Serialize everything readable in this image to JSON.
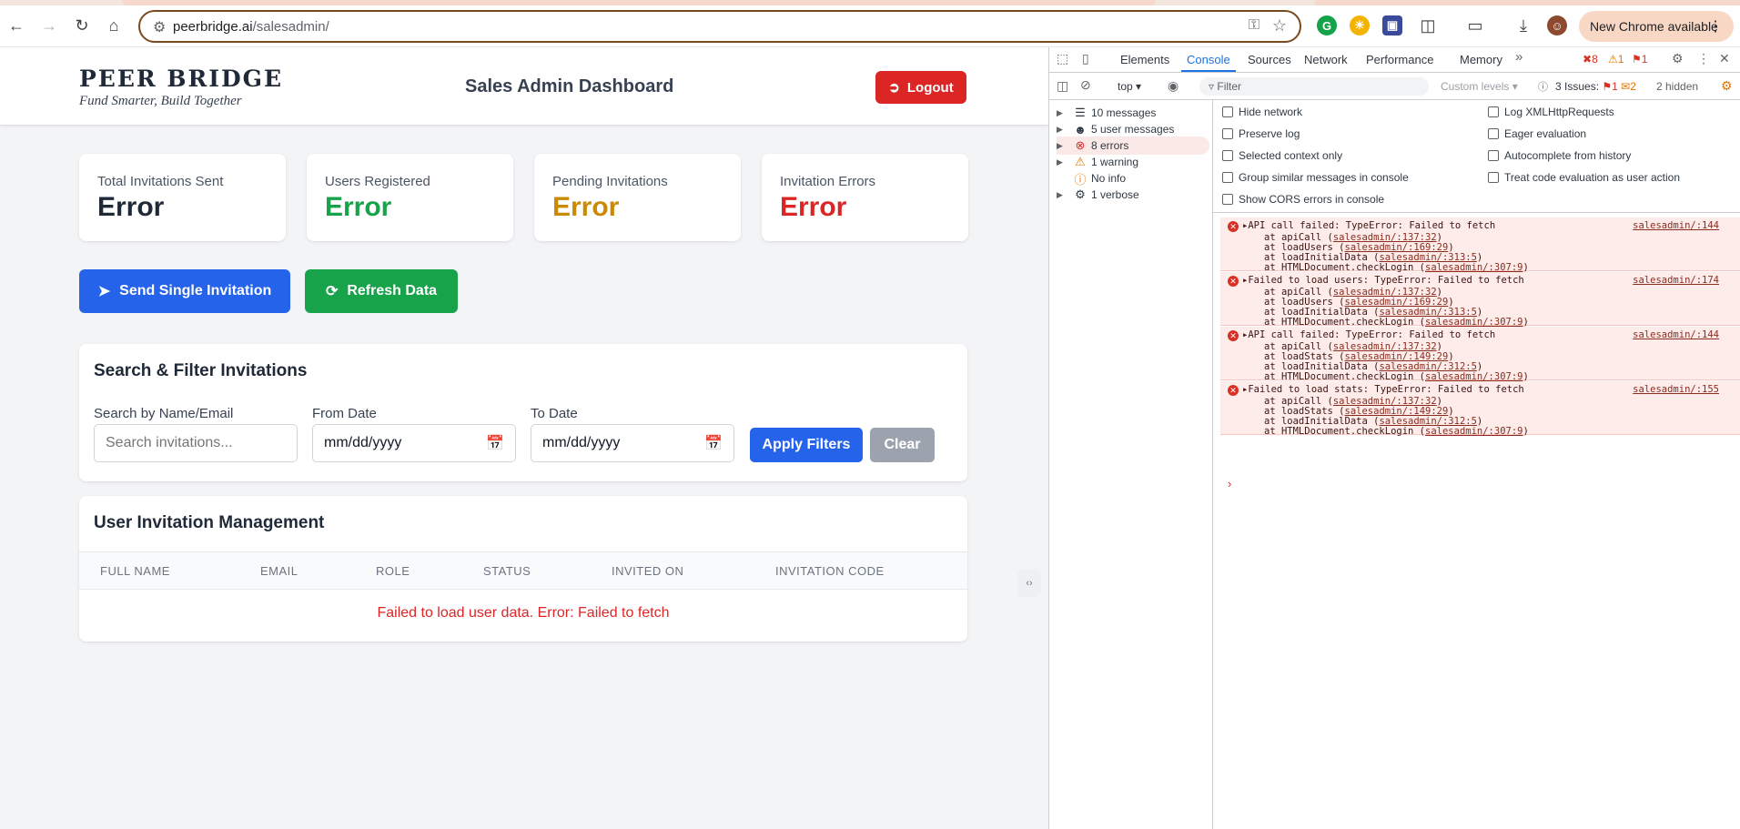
{
  "browser": {
    "url_host": "peerbridge.ai",
    "url_path": "/salesadmin/",
    "new_chrome_label": "New Chrome available"
  },
  "header": {
    "brand_name": "PEER BRIDGE",
    "brand_tagline": "Fund Smarter, Build Together",
    "title": "Sales Admin Dashboard",
    "logout_label": "Logout"
  },
  "stats": [
    {
      "label": "Total Invitations Sent",
      "value": "Error",
      "color": "#1f2937"
    },
    {
      "label": "Users Registered",
      "value": "Error",
      "color": "#16a34a"
    },
    {
      "label": "Pending Invitations",
      "value": "Error",
      "color": "#ca8a04"
    },
    {
      "label": "Invitation Errors",
      "value": "Error",
      "color": "#dc2626"
    }
  ],
  "actions": {
    "send_label": "Send Single Invitation",
    "refresh_label": "Refresh Data"
  },
  "filters": {
    "title": "Search & Filter Invitations",
    "search_label": "Search by Name/Email",
    "search_placeholder": "Search invitations...",
    "from_label": "From Date",
    "from_value": "mm/dd/yyyy",
    "to_label": "To Date",
    "to_value": "mm/dd/yyyy",
    "apply_label": "Apply Filters",
    "clear_label": "Clear"
  },
  "table": {
    "title": "User Invitation Management",
    "columns": [
      "FULL NAME",
      "EMAIL",
      "ROLE",
      "STATUS",
      "INVITED ON",
      "INVITATION CODE"
    ],
    "message": "Failed to load user data. Error: Failed to fetch"
  },
  "devtools": {
    "tabs": [
      "Elements",
      "Console",
      "Sources",
      "Network",
      "Performance",
      "Memory"
    ],
    "error_count": "8",
    "warning_count": "1",
    "issue_count": "1",
    "context": "top",
    "filter_placeholder": "Filter",
    "levels": "Custom levels",
    "issues_label": "3 Issues:",
    "issues_err": "1",
    "issues_info": "2",
    "hidden_label": "2 hidden",
    "sidebar": [
      {
        "label": "10 messages",
        "icon": "list-icon"
      },
      {
        "label": "5 user messages",
        "icon": "user-icon"
      },
      {
        "label": "8 errors",
        "icon": "error-icon"
      },
      {
        "label": "1 warning",
        "icon": "warning-icon"
      },
      {
        "label": "No info",
        "icon": "info-icon"
      },
      {
        "label": "1 verbose",
        "icon": "bug-icon"
      }
    ],
    "options_left": [
      "Hide network",
      "Preserve log",
      "Selected context only",
      "Group similar messages in console",
      "Show CORS errors in console"
    ],
    "options_right": [
      "Log XMLHttpRequests",
      "Eager evaluation",
      "Autocomplete from history",
      "Treat code evaluation as user action"
    ],
    "errors": [
      {
        "message": "API call failed: TypeError: Failed to fetch",
        "source": "salesadmin/:144",
        "stack": [
          [
            "at apiCall (",
            "salesadmin/:137:32",
            ")"
          ],
          [
            "at loadUsers (",
            "salesadmin/:169:29",
            ")"
          ],
          [
            "at loadInitialData (",
            "salesadmin/:313:5",
            ")"
          ],
          [
            "at HTMLDocument.checkLogin (",
            "salesadmin/:307:9",
            ")"
          ]
        ]
      },
      {
        "message": "Failed to load users: TypeError: Failed to fetch",
        "source": "salesadmin/:174",
        "stack": [
          [
            "at apiCall (",
            "salesadmin/:137:32",
            ")"
          ],
          [
            "at loadUsers (",
            "salesadmin/:169:29",
            ")"
          ],
          [
            "at loadInitialData (",
            "salesadmin/:313:5",
            ")"
          ],
          [
            "at HTMLDocument.checkLogin (",
            "salesadmin/:307:9",
            ")"
          ]
        ]
      },
      {
        "message": "API call failed: TypeError: Failed to fetch",
        "source": "salesadmin/:144",
        "stack": [
          [
            "at apiCall (",
            "salesadmin/:137:32",
            ")"
          ],
          [
            "at loadStats (",
            "salesadmin/:149:29",
            ")"
          ],
          [
            "at loadInitialData (",
            "salesadmin/:312:5",
            ")"
          ],
          [
            "at HTMLDocument.checkLogin (",
            "salesadmin/:307:9",
            ")"
          ]
        ]
      },
      {
        "message": "Failed to load stats: TypeError: Failed to fetch",
        "source": "salesadmin/:155",
        "stack": [
          [
            "at apiCall (",
            "salesadmin/:137:32",
            ")"
          ],
          [
            "at loadStats (",
            "salesadmin/:149:29",
            ")"
          ],
          [
            "at loadInitialData (",
            "salesadmin/:312:5",
            ")"
          ],
          [
            "at HTMLDocument.checkLogin (",
            "salesadmin/:307:9",
            ")"
          ]
        ]
      }
    ]
  }
}
